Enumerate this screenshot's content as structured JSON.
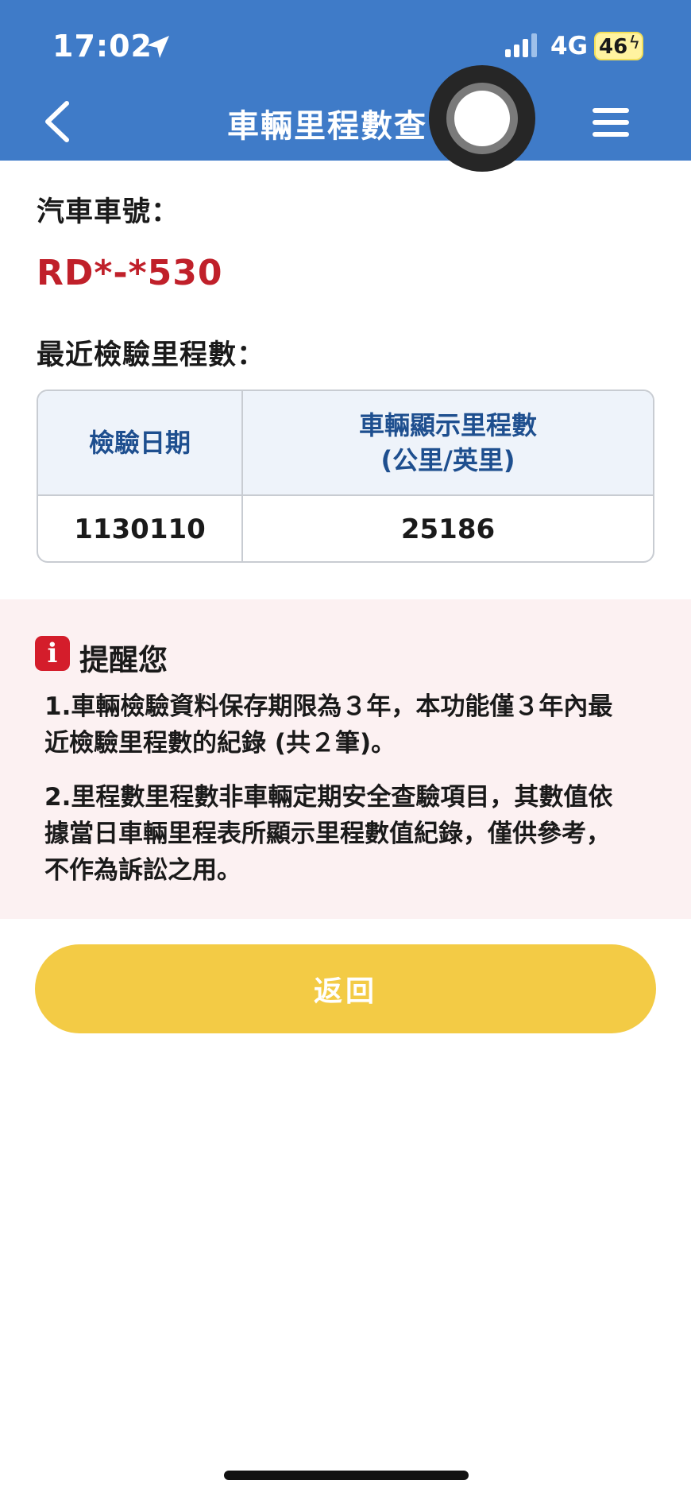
{
  "status_bar": {
    "time": "17:02",
    "network": "4G",
    "battery": "46"
  },
  "header": {
    "title": "車輛里程數查"
  },
  "vehicle": {
    "plate_label": "汽車車號：",
    "plate": "RD*-*530"
  },
  "mileage": {
    "section_label": "最近檢驗里程數：",
    "columns": [
      "檢驗日期",
      "車輛顯示里程數",
      "(公里/英里)"
    ],
    "rows": [
      {
        "date": "1130110",
        "mileage": "25186"
      }
    ]
  },
  "reminder": {
    "title": "提醒您",
    "notes": [
      [
        "1.車輛檢驗資料保存期限為３年，本功能僅３年內最",
        "近檢驗里程數的紀錄 (共２筆)。"
      ],
      [
        "2.里程數里程數非車輛定期安全查驗項目，其數值依",
        "據當日車輛里程表所顯示里程數值紀錄，僅供參考，",
        "不作為訴訟之用。"
      ]
    ]
  },
  "actions": {
    "return_label": "返回"
  },
  "colors": {
    "header": "#3f7bc8",
    "plate": "#c0202a",
    "table_header_text": "#1e4f8f",
    "reminder_bg": "#fcf1f2",
    "info_icon": "#d41d2b",
    "return_button": "#f3cb45"
  },
  "icons": [
    "location-arrow-icon",
    "signal-icon",
    "back-chevron-icon",
    "hamburger-menu-icon",
    "info-icon"
  ]
}
